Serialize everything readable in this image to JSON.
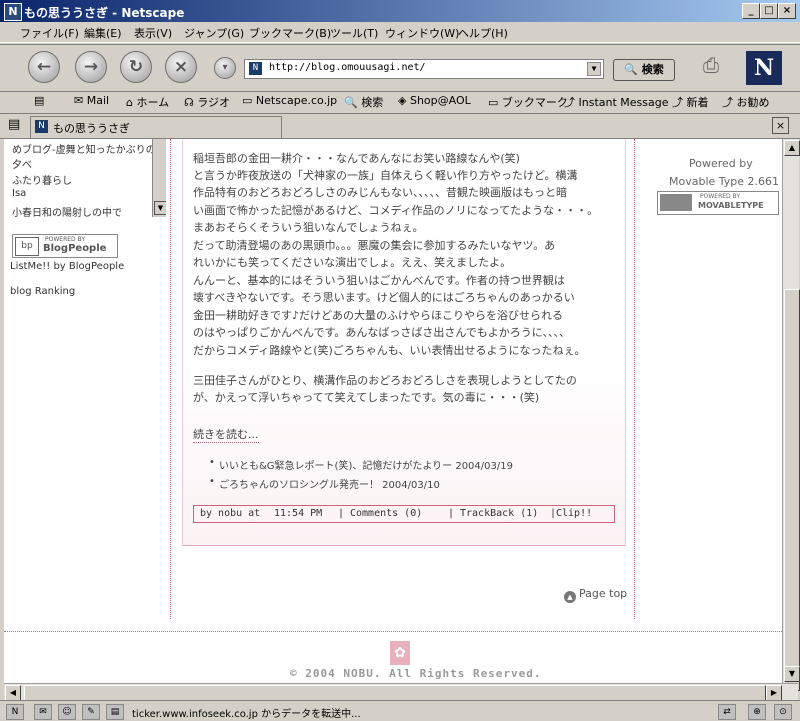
{
  "window": {
    "title": "もの思ううさぎ - Netscape",
    "app_icon": "netscape-icon"
  },
  "menu": [
    "ファイル(F)",
    "編集(E)",
    "表示(V)",
    "ジャンプ(G)",
    "ブックマーク(B)",
    "ツール(T)",
    "ウィンドウ(W)",
    "ヘルプ(H)"
  ],
  "nav": {
    "url": "http://blog.omouusagi.net/",
    "search_label": "検索",
    "logo_letter": "N"
  },
  "personal": [
    "Mail",
    "ホーム",
    "ラジオ",
    "Netscape.co.jp",
    "検索",
    "Shop@AOL",
    "ブックマーク",
    "Instant Message",
    "新着",
    "お勧め"
  ],
  "tab": {
    "label": "もの思ううさぎ"
  },
  "sidebar": {
    "links": [
      "めブログ-虚舞と知ったかぶりの",
      "夕べ",
      "ふたり暮らし",
      "Isa",
      "小春日和の陽射しの中で"
    ],
    "badge_small": "POWERED BY",
    "badge_big": "BlogPeople",
    "badge_icon": "bp",
    "listme": "ListMe!! by BlogPeople",
    "ranking": "blog Ranking"
  },
  "post": {
    "paragraphs": [
      "稲垣吾郎の金田一耕介・・・なんであんなにお笑い路線なんや(笑)",
      "と言うか昨夜放送の「犬神家の一族」自体えらく軽い作り方やったけど。横溝",
      "作品特有のおどろおどろしさのみじんもない、、、、、昔観た映画版はもっと暗",
      "い画面で怖かった記憶があるけど、コメディ作品のノリになってたような・・・。",
      "まあおそらくそういう狙いなんでしょうねぇ。",
      "だって助清登場のあの黒頭巾。。。悪魔の集会に参加するみたいなヤツ。あ",
      "れいかにも笑ってくださいな演出でしょ。ええ、笑えましたよ。",
      "んんーと、基本的にはそういう狙いはごかんべんです。作者の持つ世界観は",
      "壊すべきやないです。そう思います。けど個人的にはごろちゃんのあっかるい",
      "金田一耕助好きです♪だけどあの大量のふけやらほこりやらを浴びせられる",
      "のはやっぱりごかんべんです。あんなばっさばさ出さんでもよかろうに、、、、",
      "だからコメディ路線やと(笑)ごろちゃんも、いい表情出せるようになったねぇ。",
      "三田佳子さんがひとり、横溝作品のおどろおどろしさを表現しようとしてたの",
      "が、かえって浮いちゃってて笑えてしまったです。気の毒に・・・(笑)"
    ],
    "read_more": "続きを読む...",
    "related": [
      "いいとも&G緊急レポート(笑)、記憶だけがたよりー 2004/03/19",
      "ごろちゃんのソロシングル発売ー！ 2004/03/10"
    ],
    "footer": {
      "by": "by nobu at",
      "time": "11:54 PM",
      "comments": "Comments (0)",
      "trackback": "TrackBack (1)",
      "clip": "Clip!!",
      "sep": "|"
    }
  },
  "rightcol": {
    "powered": "Powered by",
    "mt": "Movable Type 2.661",
    "mt_badge_small": "POWERED BY",
    "mt_badge_big": "MOVABLETYPE"
  },
  "pagetop": "Page top",
  "copyright": "© 2004 NOBU. All Rights Reserved.",
  "status": {
    "text": "ticker.www.infoseek.co.jp からデータを転送中..."
  }
}
